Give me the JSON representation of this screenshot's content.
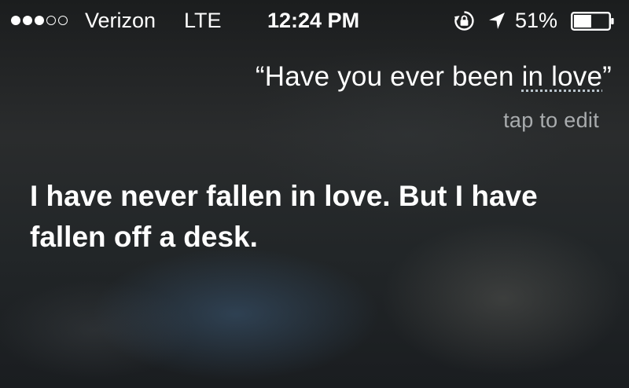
{
  "status_bar": {
    "signal_bars_filled": 3,
    "signal_bars_total": 5,
    "carrier": "Verizon",
    "network": "LTE",
    "time": "12:24 PM",
    "icons": [
      "rotation-lock-icon",
      "location-arrow-icon",
      "battery-icon"
    ],
    "battery_percent": "51%",
    "battery_level": 0.51
  },
  "siri": {
    "query_open_quote": "“",
    "query_plain": "Have you ever been ",
    "query_underlined": "in love",
    "query_close_quote": "”",
    "tap_to_edit": "tap to edit",
    "response": "I have never fallen in love. But I have fallen off a desk."
  },
  "colors": {
    "text": "#ffffff",
    "secondary_text": "#a9acae",
    "background": "#222628"
  }
}
